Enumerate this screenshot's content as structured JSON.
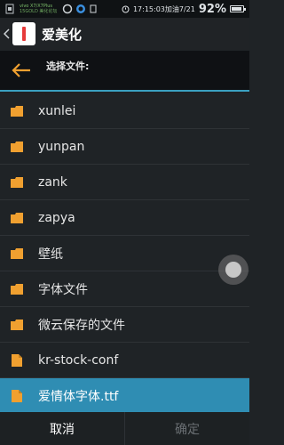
{
  "status": {
    "carrier_line1": "vivo X7/X7Plus",
    "carrier_line2": "15GOLD 美化论坛",
    "time_text": "17:15:03加油7/21",
    "battery_percent": "92%"
  },
  "app": {
    "title": "爱美化"
  },
  "dialog": {
    "title": "选择文件:",
    "accent_color": "#3aa0c0",
    "back_icon_color": "#f0a030"
  },
  "files": [
    {
      "name": "xunlei",
      "type": "folder",
      "selected": false
    },
    {
      "name": "yunpan",
      "type": "folder",
      "selected": false
    },
    {
      "name": "zank",
      "type": "folder",
      "selected": false
    },
    {
      "name": "zapya",
      "type": "folder",
      "selected": false
    },
    {
      "name": "壁纸",
      "type": "folder",
      "selected": false
    },
    {
      "name": "字体文件",
      "type": "folder",
      "selected": false
    },
    {
      "name": "微云保存的文件",
      "type": "folder",
      "selected": false
    },
    {
      "name": "kr-stock-conf",
      "type": "file",
      "selected": false
    },
    {
      "name": "爱情体字体.ttf",
      "type": "file",
      "selected": true
    }
  ],
  "buttons": {
    "cancel": "取消",
    "confirm": "确定"
  }
}
